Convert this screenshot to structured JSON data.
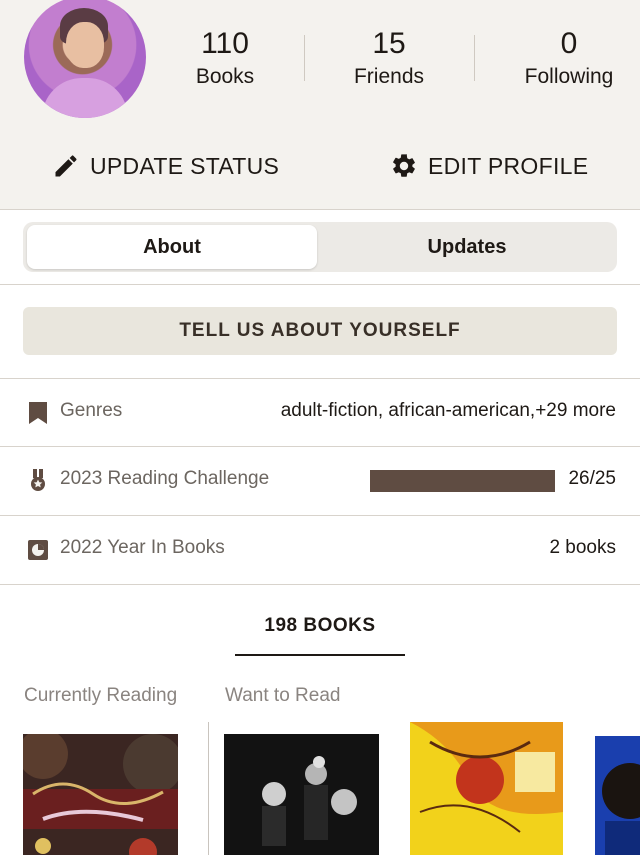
{
  "profile": {
    "stats": [
      {
        "value": "110",
        "label": "Books"
      },
      {
        "value": "15",
        "label": "Friends"
      },
      {
        "value": "0",
        "label": "Following"
      }
    ],
    "actions": {
      "update_status": "UPDATE STATUS",
      "edit_profile": "EDIT PROFILE"
    }
  },
  "tabs": {
    "about": "About",
    "updates": "Updates",
    "selected": "About"
  },
  "tell_us": "TELL US ABOUT YOURSELF",
  "rows": {
    "genres": {
      "label": "Genres",
      "value": "adult-fiction, african-american,+29 more",
      "icon": "bookmark-icon"
    },
    "challenge": {
      "label": "2023 Reading Challenge",
      "value": "26/25",
      "progress": 1.0,
      "icon": "medal-icon"
    },
    "year": {
      "label": "2022 Year In Books",
      "value": "2 books",
      "icon": "year-in-books-icon"
    }
  },
  "books_tab": "198 BOOKS",
  "shelves": {
    "currently_reading": "Currently Reading",
    "want_to_read": "Want to Read"
  },
  "colors": {
    "accent": "#5f4c42",
    "background": "#f4f2ee"
  }
}
